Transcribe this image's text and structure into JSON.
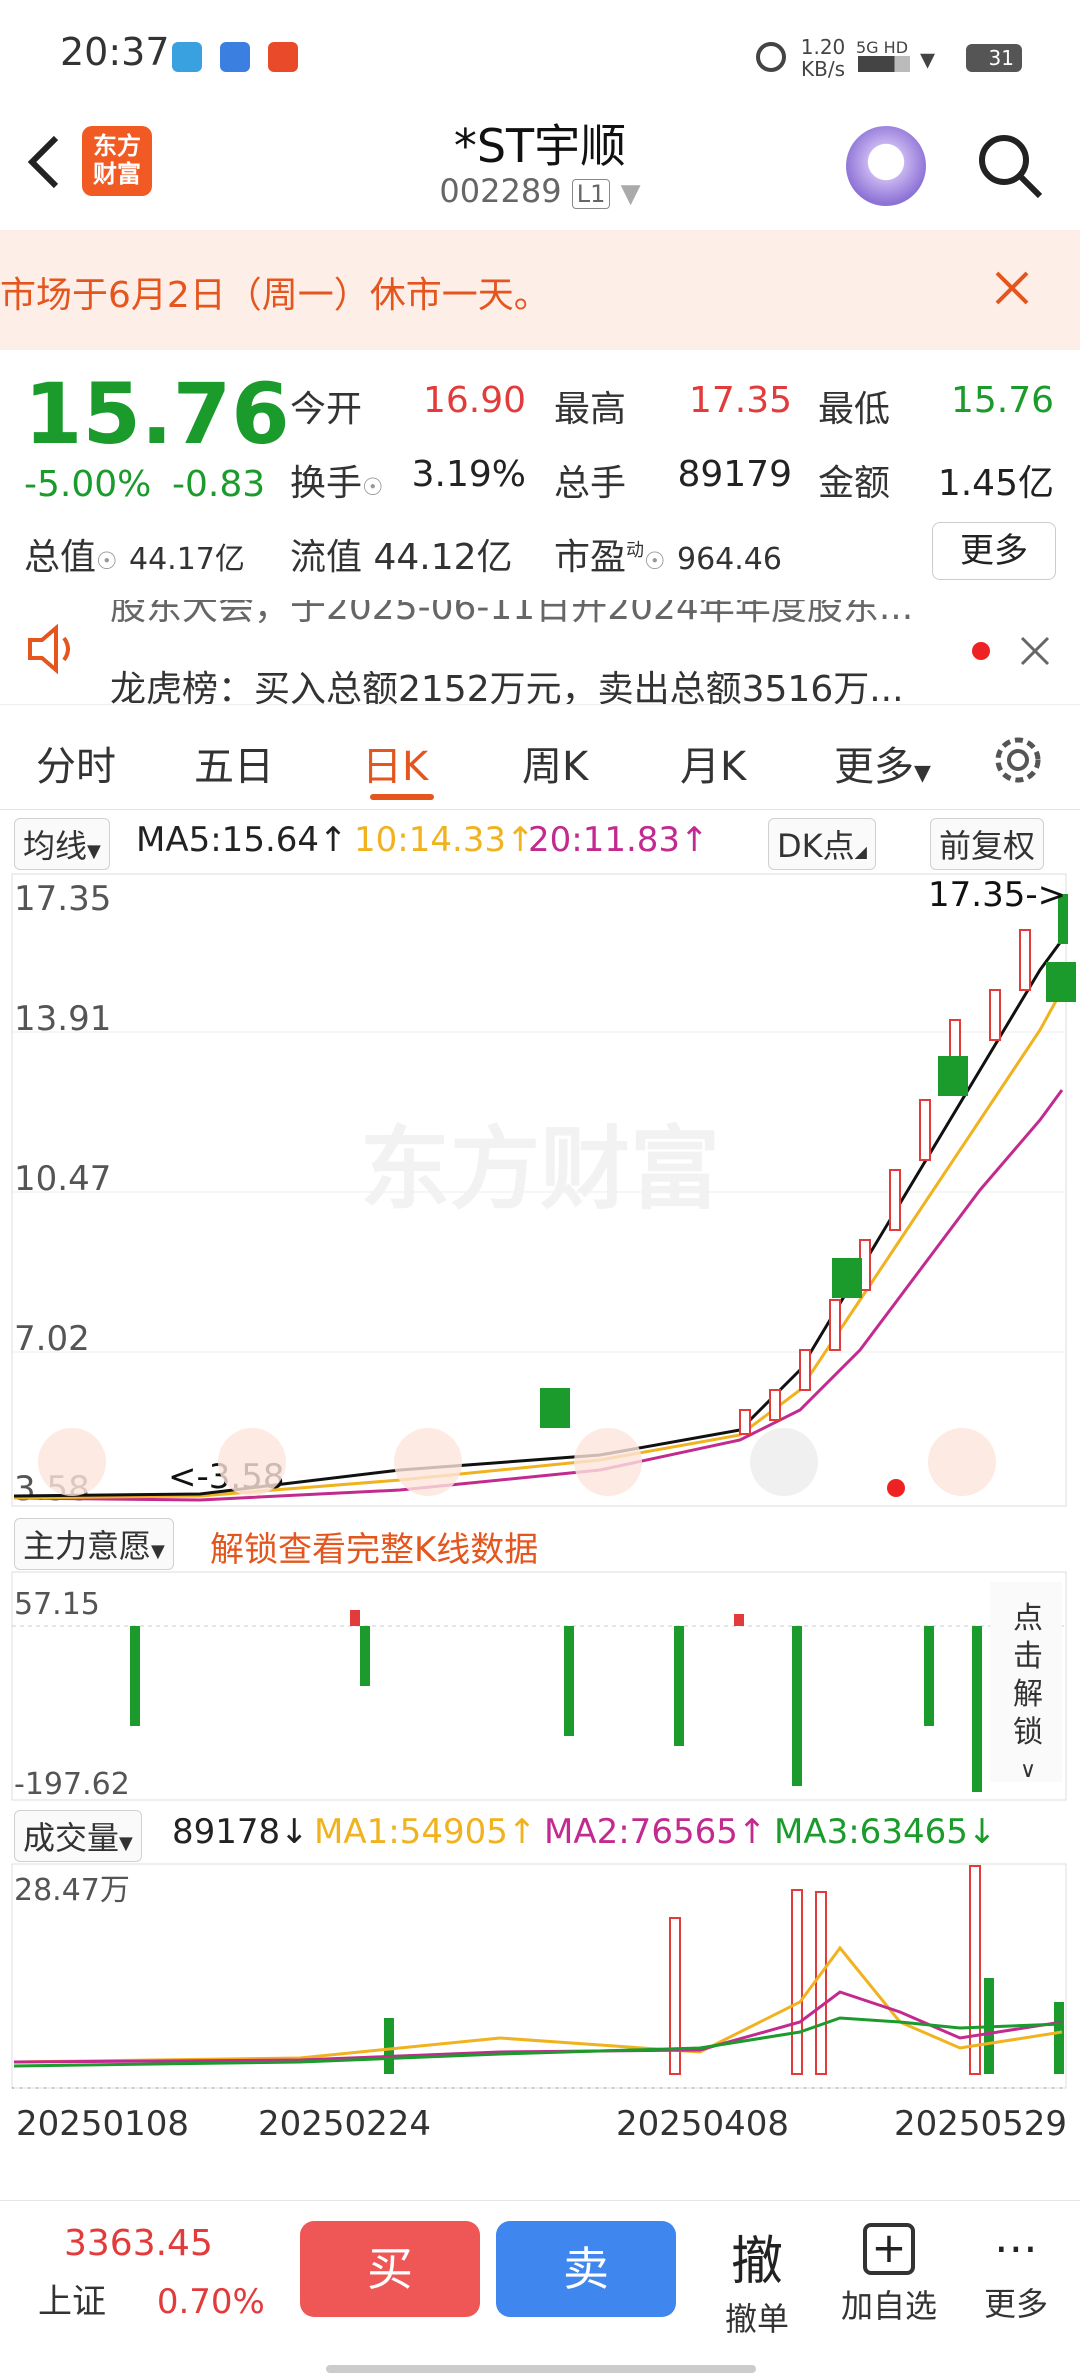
{
  "status_bar": {
    "time": "20:37",
    "net_speed": "1.20",
    "net_unit": "KB/s",
    "network": "5G HD",
    "battery": "31"
  },
  "header": {
    "back_icon": "chevron-left-icon",
    "logo_text_1": "东方",
    "logo_text_2": "财富",
    "title": "*ST宇顺",
    "code": "002289",
    "level_badge": "L1",
    "search_icon": "search-icon"
  },
  "notice": {
    "text": "市场于6月2日（周一）休市一天。"
  },
  "quote": {
    "price": "15.76",
    "change_pct": "-5.00%",
    "change_abs": "-0.83",
    "open_label": "今开",
    "open_value": "16.90",
    "high_label": "最高",
    "high_value": "17.35",
    "low_label": "最低",
    "low_value": "15.76",
    "turnover_label": "换手",
    "turnover_value": "3.19%",
    "volume_label": "总手",
    "volume_value": "89179",
    "amount_label": "金额",
    "amount_value": "1.45亿",
    "mktcap_label": "总值",
    "mktcap_value": "44.17亿",
    "float_label": "流值",
    "float_value": "44.12亿",
    "pe_label": "市盈",
    "pe_sup": "动",
    "pe_value": "964.46",
    "more_button": "更多"
  },
  "news": {
    "top_partial": "股东大会，于2025-06-11日开2024年年度股东...",
    "text": "龙虎榜：买入总额2152万元，卖出总额3516万..."
  },
  "tabs": [
    "分时",
    "五日",
    "日K",
    "周K",
    "月K",
    "更多"
  ],
  "active_tab": "日K",
  "ma_bar": {
    "selector": "均线",
    "ma5": "MA5:15.64",
    "ma10": "10:14.33",
    "ma20": "20:11.83",
    "dk_button": "DK点",
    "adjust_button": "前复权"
  },
  "kline": {
    "y_labels": [
      "17.35",
      "13.91",
      "10.47",
      "7.02",
      "3.58"
    ],
    "max_label": "17.35->",
    "min_label": "<-3.58",
    "watermark": "东方财富"
  },
  "fund_bar": {
    "selector": "主力意愿",
    "unlock_text": "解锁查看完整K线数据",
    "top_value": "57.15",
    "bottom_value": "-197.62",
    "click_unlock": "点击解锁"
  },
  "volume_bar": {
    "selector": "成交量",
    "value": "89178",
    "ma1": "MA1:54905",
    "ma2": "MA2:76565",
    "ma3": "MA3:63465",
    "top_label": "28.47万"
  },
  "dates": [
    "20250108",
    "20250224",
    "20250408",
    "20250529"
  ],
  "bottom": {
    "index_value": "3363.45",
    "index_name": "上证",
    "index_pct": "0.70%",
    "buy": "买",
    "sell": "卖",
    "cancel_icon_text": "撤",
    "cancel_label": "撤单",
    "add_label": "加自选",
    "more_label": "更多"
  },
  "colors": {
    "up": "#e13b3b",
    "down": "#1a9b2c",
    "accent": "#e4561e",
    "buy": "#ef5656",
    "sell": "#3f86ee",
    "ma5": "#111111",
    "ma10": "#f1b21f",
    "ma20": "#c22a8f"
  }
}
